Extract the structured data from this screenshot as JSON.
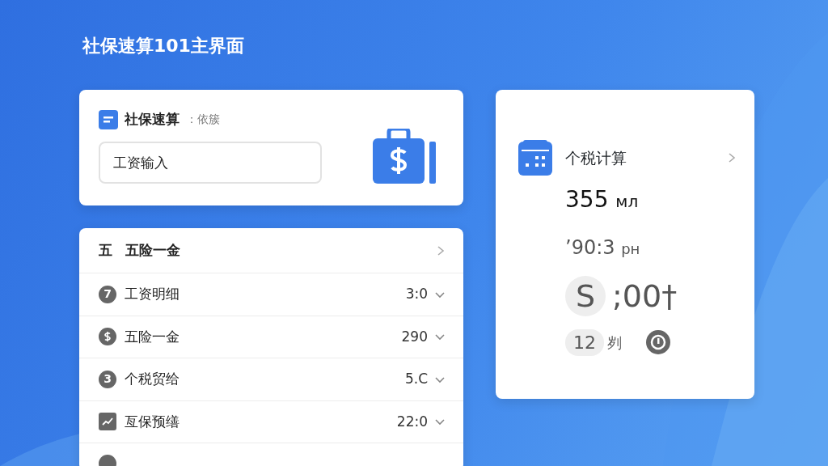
{
  "page_title": "社保速算101主界面",
  "quick_card": {
    "title": "社保速算",
    "subtitle": "：依簇",
    "input": {
      "placeholder": "工资输入"
    }
  },
  "list": {
    "header": {
      "badge": "五",
      "label": "五险一金"
    },
    "rows": [
      {
        "kind": "number",
        "badge": "7",
        "label": "工资明细",
        "value": "3:0",
        "expanded": false
      },
      {
        "kind": "dollar",
        "label": "五险一金",
        "value": "290",
        "expanded": false
      },
      {
        "kind": "number",
        "badge": "3",
        "label": "个税贸给",
        "value": "5.C",
        "expanded": false
      },
      {
        "kind": "chart",
        "label": "亙保预缮",
        "value": "22:0",
        "expanded": false
      },
      {
        "kind": "cut"
      }
    ]
  },
  "tax_card": {
    "title": "个税计算",
    "amount": "355",
    "amount_unit": "мл",
    "time": "’90:3",
    "time_unit": "pн",
    "big_badge": "S",
    "big_value": ";00",
    "big_suffix": "†",
    "small_badge": "12",
    "small_label": "刿"
  }
}
